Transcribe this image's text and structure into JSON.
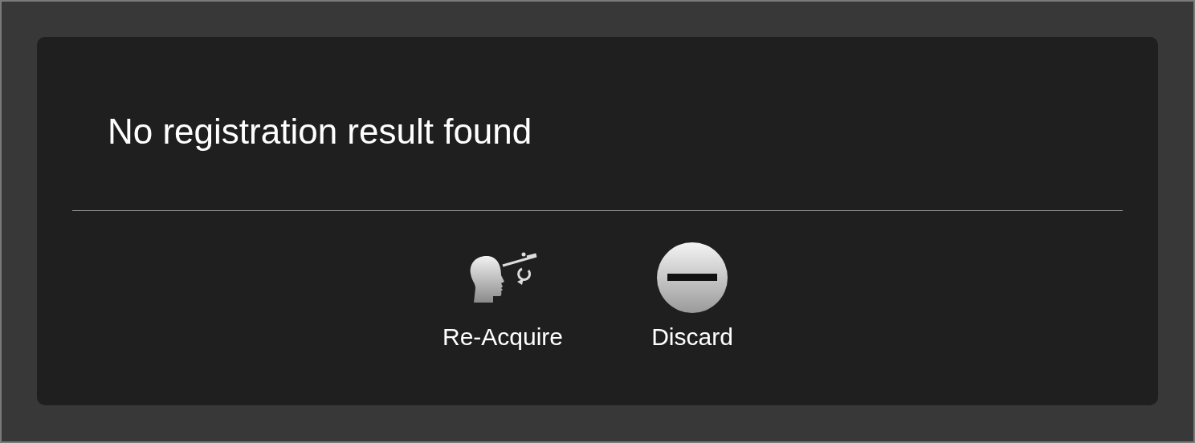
{
  "dialog": {
    "message": "No registration result found",
    "buttons": [
      {
        "kind": "reacquire",
        "label": "Re-Acquire"
      },
      {
        "kind": "discard",
        "label": "Discard"
      }
    ]
  }
}
